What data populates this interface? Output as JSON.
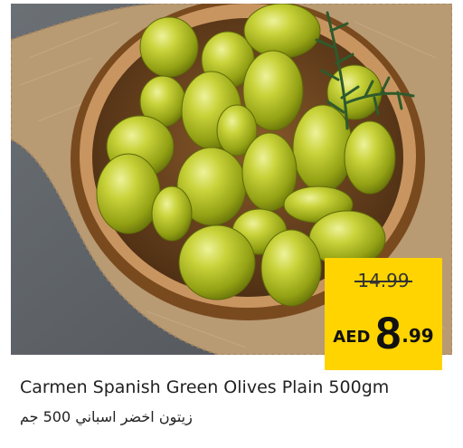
{
  "product": {
    "name_en": "Carmen Spanish Green Olives Plain 500gm",
    "name_ar": "زيتون اخضر اسباني 500 جم",
    "image_subject": "bowl-of-green-olives-image"
  },
  "price": {
    "old": "14.99",
    "currency": "AED",
    "new_major": "8",
    "new_minor": ".99"
  },
  "colors": {
    "price_badge": "#ffd400",
    "background": "#ffffff"
  }
}
